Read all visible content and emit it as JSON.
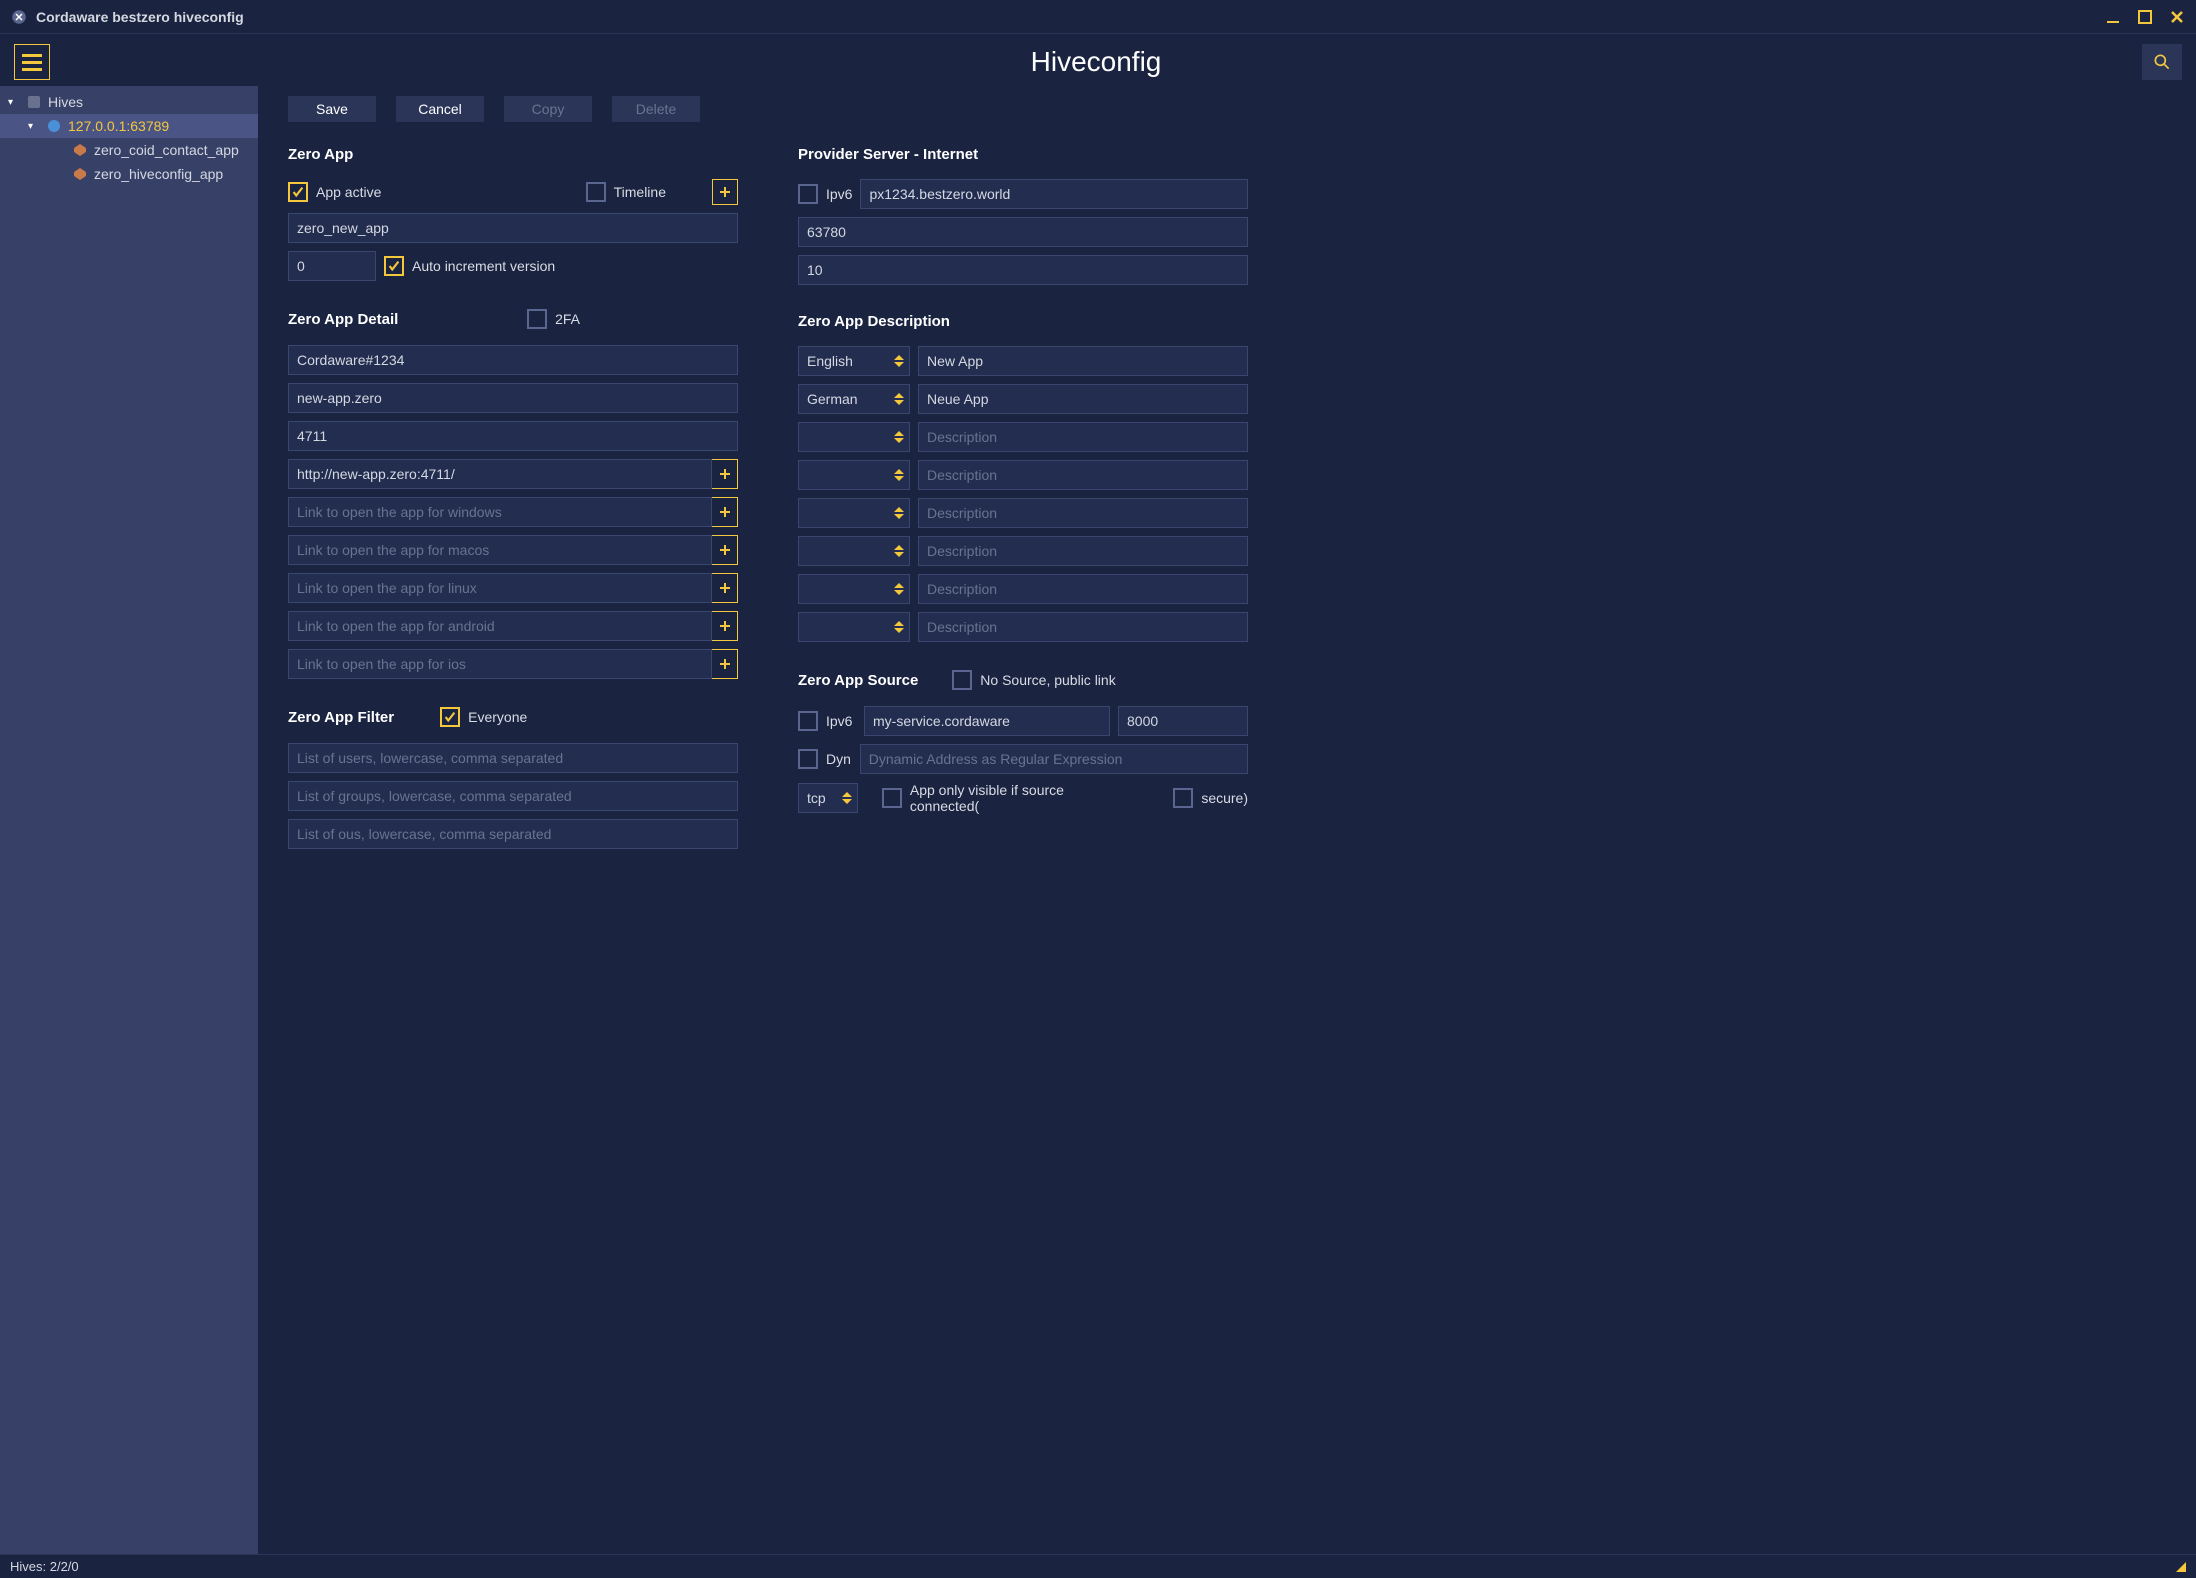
{
  "window": {
    "title": "Cordaware bestzero hiveconfig"
  },
  "header": {
    "title": "Hiveconfig"
  },
  "sidebar": {
    "root": "Hives",
    "node": "127.0.0.1:63789",
    "child1": "zero_coid_contact_app",
    "child2": "zero_hiveconfig_app"
  },
  "toolbar": {
    "save": "Save",
    "cancel": "Cancel",
    "copy": "Copy",
    "delete": "Delete"
  },
  "zeroapp": {
    "title": "Zero App",
    "app_active": "App active",
    "timeline": "Timeline",
    "name_value": "zero_new_app",
    "version_value": "0",
    "auto_increment": "Auto increment version"
  },
  "detail": {
    "title": "Zero App Detail",
    "twofa": "2FA",
    "v1": "Cordaware#1234",
    "v2": "new-app.zero",
    "v3": "4711",
    "v4": "http://new-app.zero:4711/",
    "p_windows": "Link to open the app for windows",
    "p_macos": "Link to open the app for macos",
    "p_linux": "Link to open the app for linux",
    "p_android": "Link to open the app for android",
    "p_ios": "Link to open the app for ios"
  },
  "filter": {
    "title": "Zero App Filter",
    "everyone": "Everyone",
    "p_users": "List of users, lowercase, comma separated",
    "p_groups": "List of groups, lowercase, comma separated",
    "p_ous": "List of ous, lowercase, comma separated"
  },
  "provider": {
    "title": "Provider Server - Internet",
    "ipv6": "Ipv6",
    "host": "px1234.bestzero.world",
    "port": "63780",
    "val3": "10"
  },
  "description": {
    "title": "Zero App Description",
    "english": "English",
    "german": "German",
    "new_app": "New App",
    "neue_app": "Neue App",
    "ph": "Description"
  },
  "source": {
    "title": "Zero App Source",
    "no_source": "No Source, public link",
    "ipv6": "Ipv6",
    "host": "my-service.cordaware",
    "port": "8000",
    "dyn": "Dyn",
    "dyn_ph": "Dynamic Address as Regular Expression",
    "tcp": "tcp",
    "app_only": "App only visible if source connected(",
    "secure": "secure)"
  },
  "status": {
    "text": "Hives: 2/2/0"
  }
}
